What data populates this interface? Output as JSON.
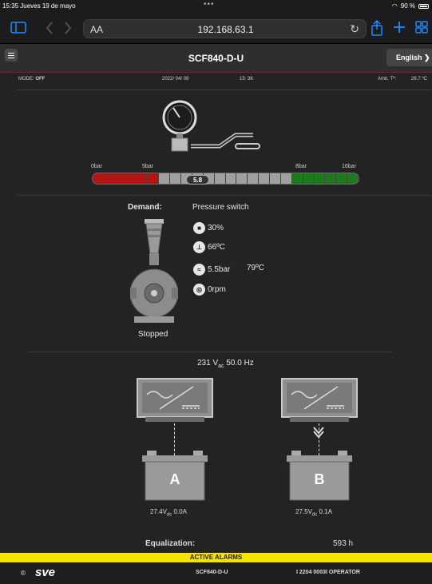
{
  "status_bar": {
    "time_date": "15:35  Jueves 19 de mayo",
    "dots": "•••",
    "battery": "90 %"
  },
  "browser": {
    "aa": "AA",
    "url": "192.168.63.1"
  },
  "header": {
    "title": "SCF840-D-U",
    "language": "English"
  },
  "info": {
    "mode_label": "MODE:",
    "mode_value": "OFF",
    "date": "2022/ 04/ 08",
    "time": "15: 36",
    "amb_label": "Amb. Tª:",
    "amb_value": "26.7 ºC"
  },
  "pressure": {
    "labels": [
      "0bar",
      "5bar",
      "8bar",
      "16bar"
    ],
    "value": "5.8",
    "level": 0.36
  },
  "pump": {
    "demand_label": "Demand:",
    "demand_value": "Pressure switch",
    "fuel": "30%",
    "temperature": "66ºC",
    "oil_pressure": "5.5bar",
    "oil_temp": "79ºC",
    "speed": "0rpm",
    "status": "Stopped"
  },
  "supply": {
    "line": "231 V",
    "sub": "ac",
    "freq": " 50.0 Hz"
  },
  "battery_a": {
    "label": "A",
    "volts": "27.4V",
    "sub": "dc",
    "amps": " 0.0A"
  },
  "battery_b": {
    "label": "B",
    "volts": "27.5V",
    "sub": "dc",
    "amps": " 0.1A"
  },
  "equalization": {
    "label": "Equalization:",
    "value": "593 h"
  },
  "alarms": {
    "label": "ACTIVE ALARMS"
  },
  "footer": {
    "copyright": "©",
    "brand": "sve",
    "model": "SCF840-D-U",
    "user": "I 2204 0003I OPERATOR"
  }
}
